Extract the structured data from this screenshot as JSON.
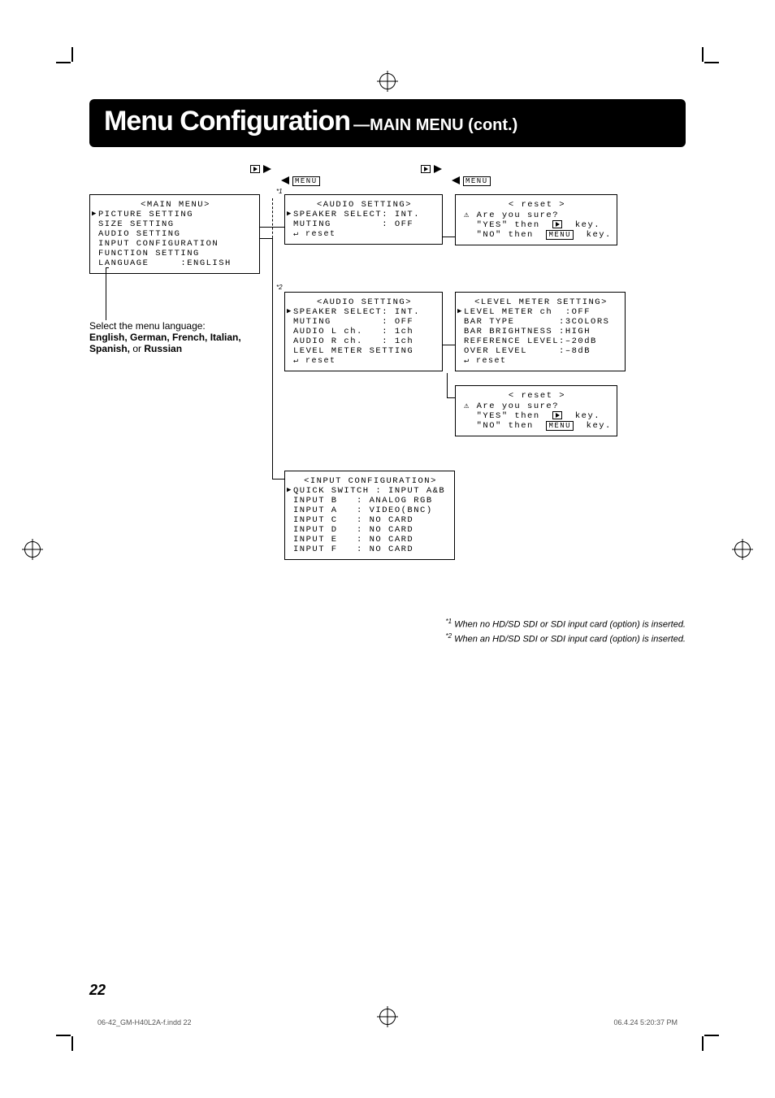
{
  "title": {
    "big": "Menu Configuration",
    "sub": "—MAIN MENU (cont.)"
  },
  "nav": {
    "menu_label": "MENU"
  },
  "star1": "*1",
  "star2": "*2",
  "main_menu": {
    "header": "<MAIN MENU>",
    "items": [
      "PICTURE SETTING",
      "SIZE SETTING",
      "AUDIO SETTING",
      "INPUT CONFIGURATION",
      "FUNCTION SETTING",
      "LANGUAGE     :ENGLISH"
    ]
  },
  "language_caption": {
    "line1": "Select the menu language:",
    "line2": "English, German, French, Italian, Spanish,",
    "line3_plain": " or ",
    "line3_bold": "Russian"
  },
  "audio1": {
    "header": "<AUDIO SETTING>",
    "items": [
      "SPEAKER SELECT: INT.",
      "MUTING        : OFF"
    ],
    "reset": "↵ reset"
  },
  "audio2": {
    "header": "<AUDIO SETTING>",
    "items": [
      "SPEAKER SELECT: INT.",
      "MUTING        : OFF",
      "AUDIO L ch.   : 1ch",
      "AUDIO R ch.   : 1ch",
      "LEVEL METER SETTING"
    ],
    "reset": "↵ reset"
  },
  "reset_dialog": {
    "header": "< reset >",
    "warn": "⚠ Are you sure?",
    "yes": "\"YES\" then",
    "no": "\"NO\" then",
    "key": "key.",
    "menu_box": "MENU"
  },
  "level_meter": {
    "header": "<LEVEL METER SETTING>",
    "items": [
      "LEVEL METER ch  :OFF",
      "BAR TYPE       :3COLORS",
      "BAR BRIGHTNESS :HIGH",
      "REFERENCE LEVEL:–20dB",
      "OVER LEVEL     :–8dB"
    ],
    "reset": "↵ reset"
  },
  "input_config": {
    "header": "<INPUT CONFIGURATION>",
    "items": [
      "QUICK SWITCH : INPUT A&B",
      "INPUT B   : ANALOG RGB",
      "",
      "INPUT A   : VIDEO(BNC)",
      "INPUT C   : NO CARD",
      "INPUT D   : NO CARD",
      "INPUT E   : NO CARD",
      "INPUT F   : NO CARD"
    ]
  },
  "footnotes": {
    "f1": "When no HD/SD SDI or SDI input card (option) is inserted.",
    "f2": "When an HD/SD SDI or SDI input card (option) is inserted."
  },
  "page_number": "22",
  "footer": {
    "left": "06-42_GM-H40L2A-f.indd   22",
    "right": "06.4.24   5:20:37 PM"
  }
}
